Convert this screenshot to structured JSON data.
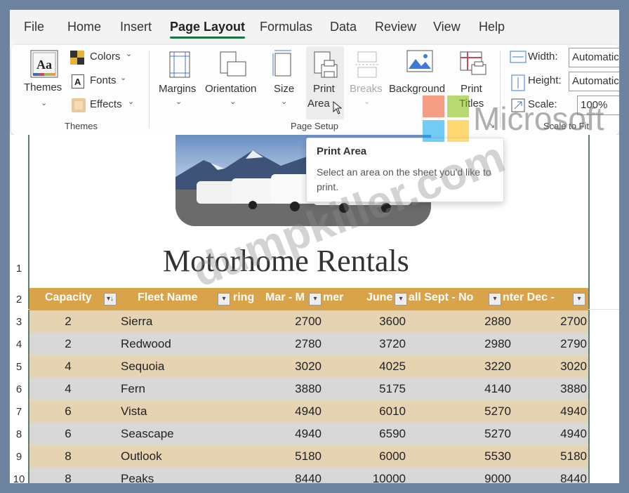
{
  "menu": {
    "tabs": [
      "File",
      "Home",
      "Insert",
      "Page Layout",
      "Formulas",
      "Data",
      "Review",
      "View",
      "Help"
    ]
  },
  "ribbon": {
    "themes": {
      "themes_label": "Themes",
      "colors_label": "Colors",
      "fonts_label": "Fonts",
      "effects_label": "Effects",
      "group_label": "Themes"
    },
    "page_setup": {
      "margins_label": "Margins",
      "orientation_label": "Orientation",
      "size_label": "Size",
      "print_area_label_1": "Print",
      "print_area_label_2": "Area",
      "breaks_label": "Breaks",
      "background_label": "Background",
      "print_titles_label_1": "Print",
      "print_titles_label_2": "Titles",
      "group_label": "Page Setup"
    },
    "scale_to_fit": {
      "width_label": "Width:",
      "width_value": "Automatic",
      "height_label": "Height:",
      "height_value": "Automatic",
      "scale_label": "Scale:",
      "scale_value": "100%",
      "group_label": "Scale to Fit"
    }
  },
  "tooltip": {
    "title": "Print Area",
    "description": "Select an area on the sheet you'd like to print."
  },
  "sheet": {
    "title": "Motorhome Rentals",
    "row_numbers": [
      "1",
      "2",
      "3",
      "4",
      "5",
      "6",
      "7",
      "8",
      "9",
      "10"
    ],
    "headers": [
      "Capacity",
      "Fleet Name",
      "ring",
      "Mar - M",
      "mer",
      "June",
      "all Sept - No",
      "nter Dec -"
    ],
    "rows": [
      [
        "2",
        "Sierra",
        "2700",
        "3600",
        "2880",
        "2700"
      ],
      [
        "2",
        "Redwood",
        "2780",
        "3720",
        "2980",
        "2790"
      ],
      [
        "4",
        "Sequoia",
        "3020",
        "4025",
        "3220",
        "3020"
      ],
      [
        "4",
        "Fern",
        "3880",
        "5175",
        "4140",
        "3880"
      ],
      [
        "6",
        "Vista",
        "4940",
        "6010",
        "5270",
        "4940"
      ],
      [
        "6",
        "Seascape",
        "4940",
        "6590",
        "5270",
        "4940"
      ],
      [
        "8",
        "Outlook",
        "5180",
        "6000",
        "5530",
        "5180"
      ],
      [
        "8",
        "Peaks",
        "8440",
        "10000",
        "9000",
        "8440"
      ]
    ]
  },
  "watermarks": {
    "brand": "Microsoft",
    "site": "dumpkiller.com"
  },
  "colors": {
    "header_gold": "#d9a34a",
    "row_tan": "#e6d3b2",
    "row_gray": "#d8d8d8",
    "accent_green": "#1e7145"
  }
}
